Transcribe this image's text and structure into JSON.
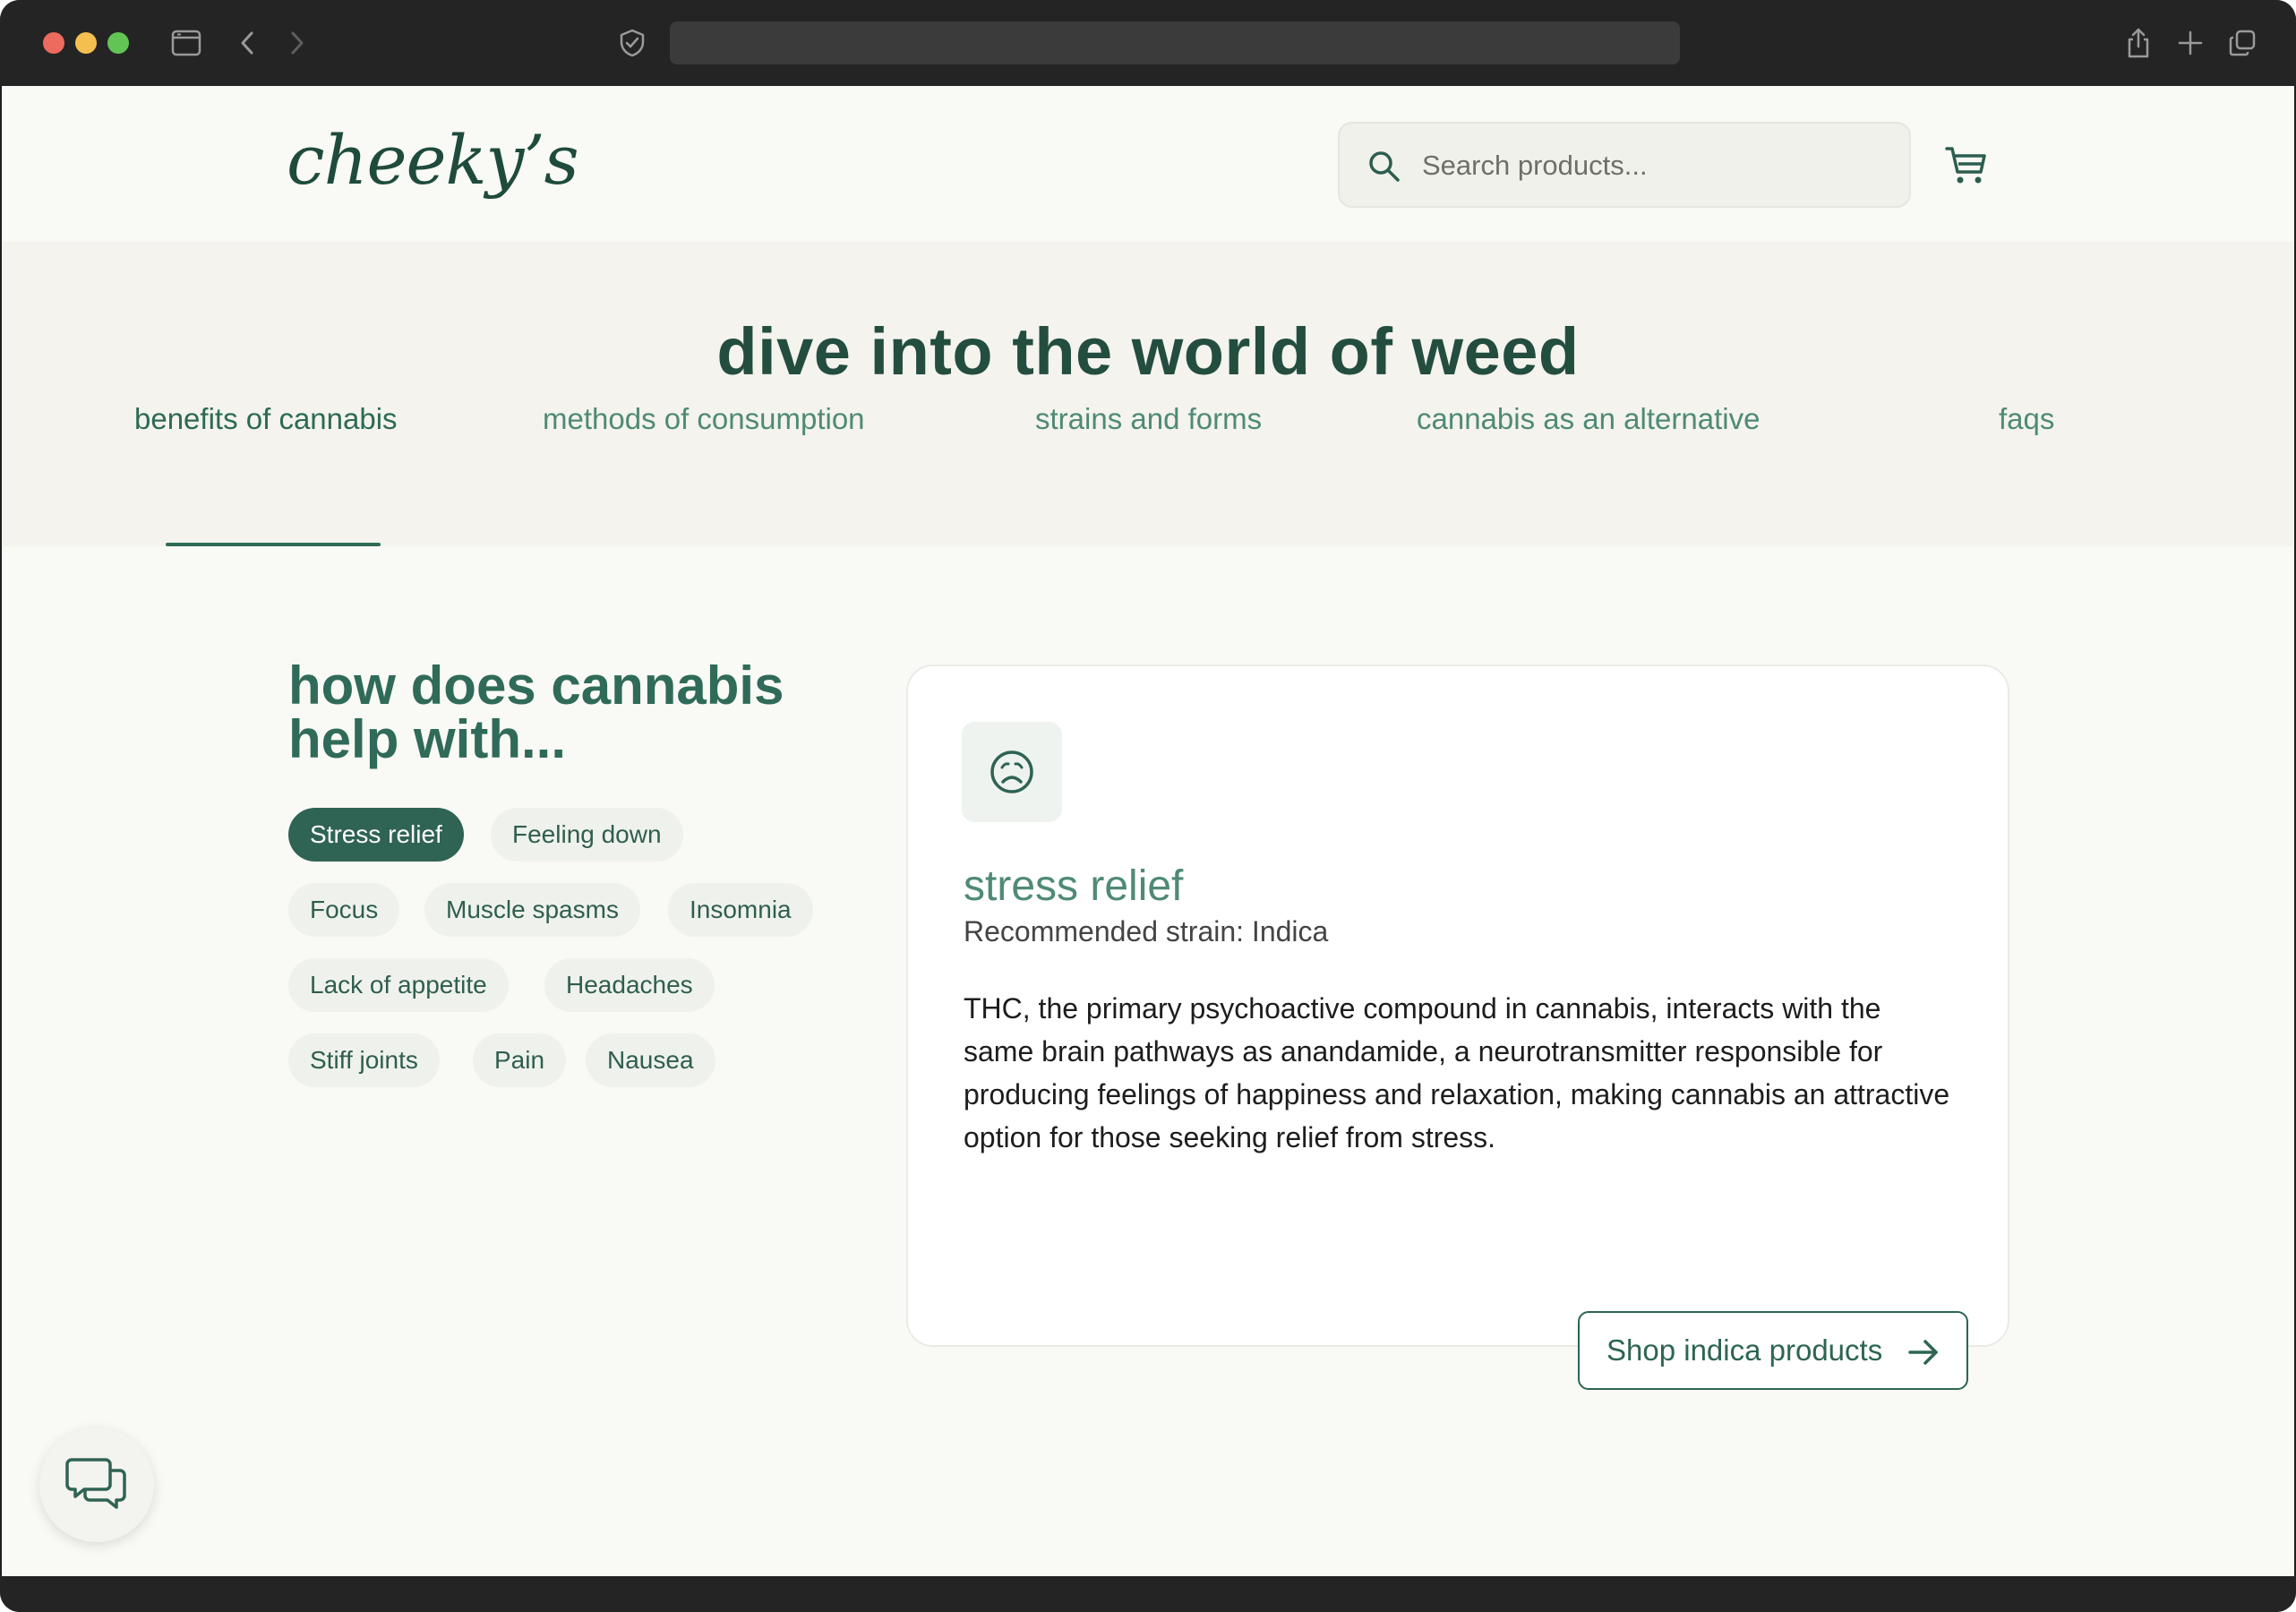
{
  "header": {
    "logo": "cheeky’s",
    "search_placeholder": "Search products..."
  },
  "hero": {
    "title": "dive into the world of weed"
  },
  "tabs": [
    {
      "label": "benefits of cannabis"
    },
    {
      "label": "methods of consumption"
    },
    {
      "label": "strains and forms"
    },
    {
      "label": "cannabis as an alternative"
    },
    {
      "label": "faqs"
    }
  ],
  "help": {
    "heading_line1": "how does cannabis",
    "heading_line2": "help with...",
    "chips": [
      "Stress relief",
      "Feeling down",
      "Focus",
      "Muscle spasms",
      "Insomnia",
      "Lack of appetite",
      "Headaches",
      "Stiff joints",
      "Pain",
      "Nausea"
    ]
  },
  "card": {
    "icon": "frown-face-icon",
    "title": "stress relief",
    "subtitle": "Recommended strain: Indica",
    "body": "THC, the primary psychoactive compound in cannabis, interacts with the same brain pathways as anandamide, a neurotransmitter responsible for producing feelings of happiness and relaxation, making cannabis an attractive option for those seeking relief from stress.",
    "button_label": "Shop indica products"
  },
  "colors": {
    "brand_green": "#2f6354",
    "accent_green": "#4f8a76",
    "page_bg": "#f9f9f5"
  }
}
